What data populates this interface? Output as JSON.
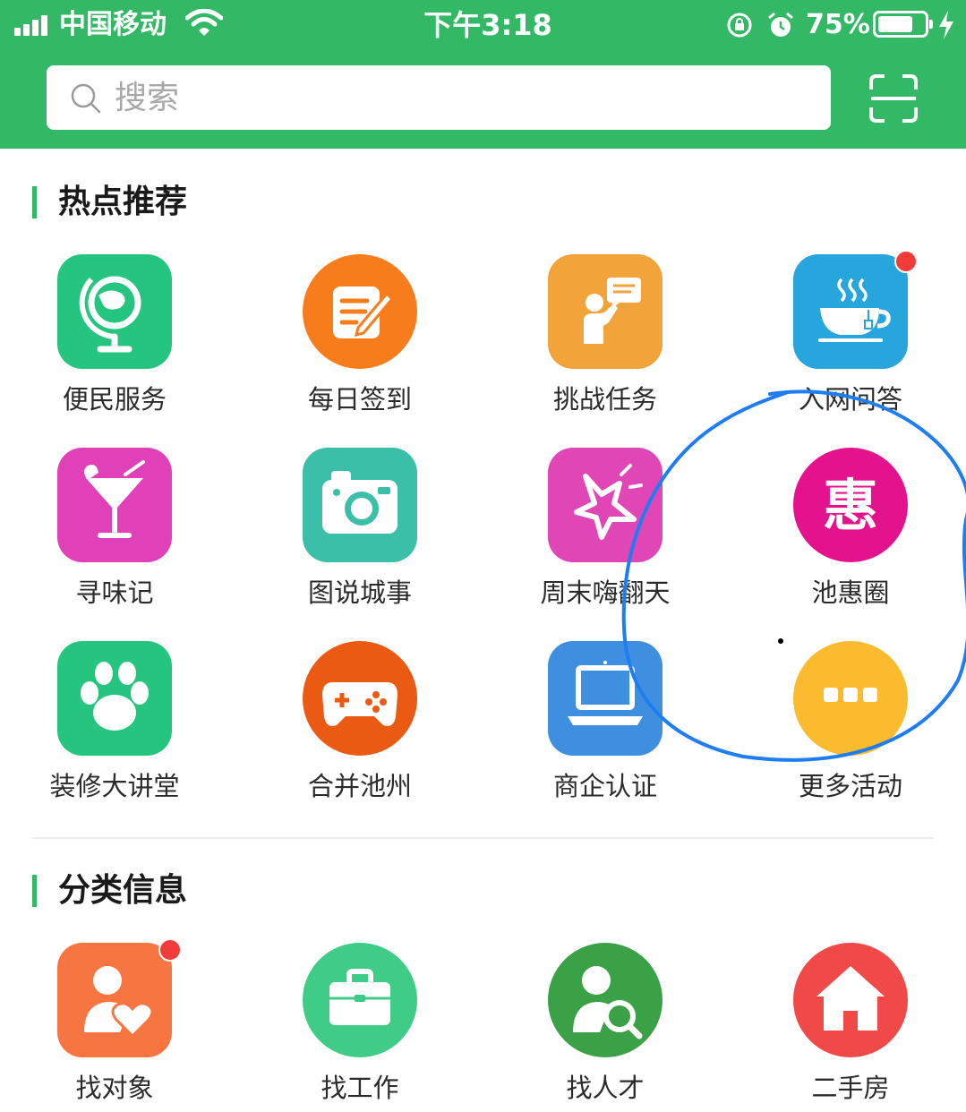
{
  "status_bar": {
    "carrier": "中国移动",
    "time": "下午3:18",
    "battery_pct": "75%",
    "battery_level": 0.75
  },
  "search": {
    "placeholder": "搜索"
  },
  "sections": [
    {
      "title": "热点推荐",
      "items": [
        {
          "label": "便民服务",
          "icon": "globe-icon",
          "color": "#25c57f",
          "shape": "square",
          "badge": false
        },
        {
          "label": "每日签到",
          "icon": "notepad-pen-icon",
          "color": "#f77d1c",
          "shape": "circle",
          "badge": false
        },
        {
          "label": "挑战任务",
          "icon": "presenter-icon",
          "color": "#f2a33a",
          "shape": "square",
          "badge": false
        },
        {
          "label": "入网问答",
          "icon": "coffee-cup-icon",
          "color": "#27a6de",
          "shape": "square",
          "badge": true
        },
        {
          "label": "寻味记",
          "icon": "cocktail-icon",
          "color": "#e041b8",
          "shape": "square",
          "badge": false
        },
        {
          "label": "图说城事",
          "icon": "camera-icon",
          "color": "#3bbfa8",
          "shape": "square",
          "badge": false
        },
        {
          "label": "周末嗨翻天",
          "icon": "star-burst-icon",
          "color": "#e046b6",
          "shape": "square",
          "badge": false
        },
        {
          "label": "池惠圈",
          "icon": "hui-character-icon",
          "glyph": "惠",
          "color": "#e5128d",
          "shape": "circle",
          "badge": false
        },
        {
          "label": "装修大讲堂",
          "icon": "paw-icon",
          "color": "#25c57f",
          "shape": "square",
          "badge": false
        },
        {
          "label": "合并池州",
          "icon": "gamepad-icon",
          "color": "#ea5a12",
          "shape": "circle",
          "badge": false
        },
        {
          "label": "商企认证",
          "icon": "laptop-icon",
          "color": "#3f8fe0",
          "shape": "square",
          "badge": false
        },
        {
          "label": "更多活动",
          "icon": "more-dots-icon",
          "color": "#fbbb2f",
          "shape": "circle",
          "badge": false
        }
      ]
    },
    {
      "title": "分类信息",
      "items": [
        {
          "label": "找对象",
          "icon": "person-heart-icon",
          "color": "#f77540",
          "shape": "square",
          "badge": true
        },
        {
          "label": "找工作",
          "icon": "briefcase-icon",
          "color": "#3fcc86",
          "shape": "circle",
          "badge": false
        },
        {
          "label": "找人才",
          "icon": "person-search-icon",
          "color": "#3aa146",
          "shape": "circle",
          "badge": false
        },
        {
          "label": "二手房",
          "icon": "house-icon",
          "color": "#f14848",
          "shape": "circle",
          "badge": false
        }
      ]
    }
  ],
  "annotation_color": "#1e7df0"
}
